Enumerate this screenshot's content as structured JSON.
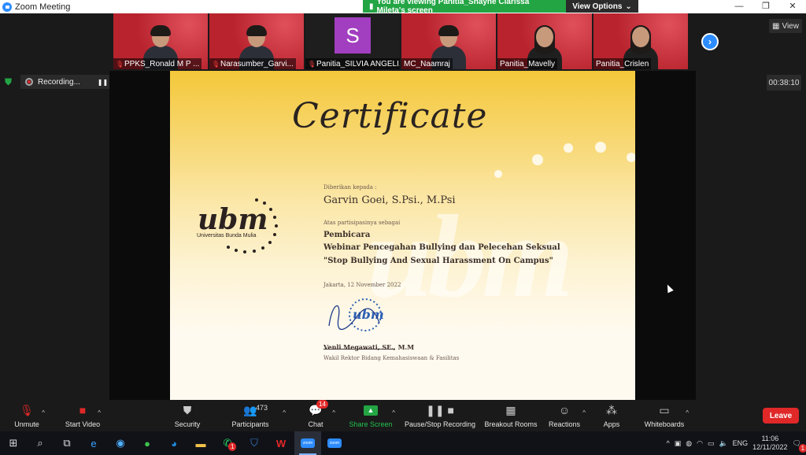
{
  "window": {
    "title": "Zoom Meeting",
    "controls": [
      "—",
      "❐",
      "✕"
    ]
  },
  "banner": {
    "viewing_text": "You are viewing Panitia_Shayne Clarissa Mileta's screen",
    "options_label": "View Options"
  },
  "view_button": {
    "label": "View"
  },
  "participants_strip": [
    {
      "name": "PPKS_Ronald M P ...",
      "type": "video",
      "muted": true
    },
    {
      "name": "Narasumber_Garvi...",
      "type": "video",
      "muted": true
    },
    {
      "name": "Panitia_SILVIA ANGELI...",
      "type": "avatar",
      "initial": "S",
      "muted": true
    },
    {
      "name": "MC_Naamraj",
      "type": "video",
      "muted": false,
      "active": true
    },
    {
      "name": "Panitia_Mavelly",
      "type": "video",
      "muted": false
    },
    {
      "name": "Panitia_Crislen",
      "type": "video",
      "muted": false
    }
  ],
  "recording": {
    "label": "Recording...",
    "timer": "00:38:10"
  },
  "certificate": {
    "title": "Certificate",
    "given_to_label": "Diberikan kepada :",
    "recipient": "Garvin Goei, S.Psi., M.Psi",
    "participation_label": "Atas partisipasinya sebagai",
    "role": "Pembicara",
    "event": "Webinar Pencegahan Bullying dan Pelecehan Seksual",
    "theme": "\"Stop Bullying And Sexual Harassment On Campus\"",
    "place_date": "Jakarta, 12 November 2022",
    "signatory": "Venli Megawati, SE., M.M",
    "signatory_title": "Wakil Rektor Bidang Kemahasiswaan & Fasilitas",
    "logo_text": "ubm",
    "logo_subtext": "Universitas Bunda Mulia",
    "watermark": "ubm"
  },
  "toolbar": {
    "unmute": "Unmute",
    "start_video": "Start Video",
    "security": "Security",
    "participants": "Participants",
    "participants_count": "473",
    "chat": "Chat",
    "chat_badge": "14",
    "share_screen": "Share Screen",
    "record": "Pause/Stop Recording",
    "breakout": "Breakout Rooms",
    "reactions": "Reactions",
    "apps": "Apps",
    "whiteboards": "Whiteboards",
    "leave": "Leave"
  },
  "taskbar": {
    "lang": "ENG",
    "time": "11:06",
    "date": "12/11/2022",
    "notification_count": "1",
    "whatsapp_badge": "1",
    "zoom_label": "zoom"
  },
  "colors": {
    "accent": "#2d8cff",
    "share_green": "#23a544",
    "leave_red": "#e02828"
  }
}
